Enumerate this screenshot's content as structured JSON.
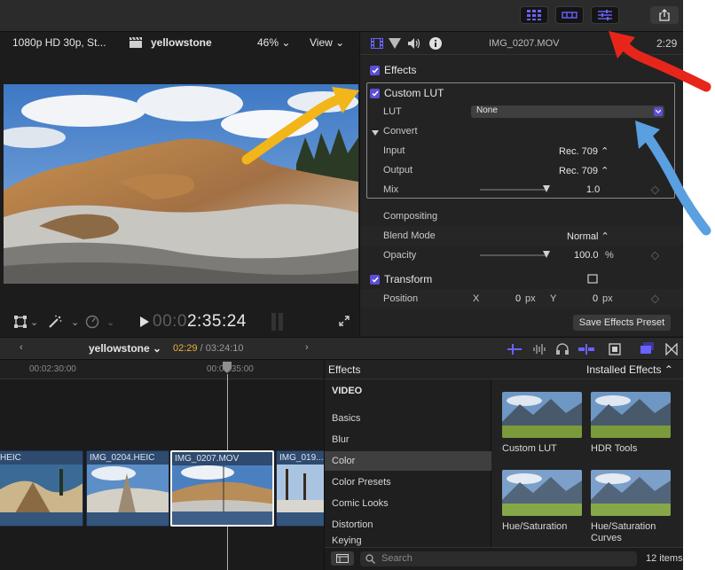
{
  "toolbar": {
    "icons": [
      "library-grid-icon",
      "timeline-icon",
      "inspector-sliders-icon",
      "share-icon"
    ]
  },
  "viewer": {
    "format": "1080p HD 30p, St...",
    "project": "yellowstone",
    "zoom": "46%",
    "view_menu": "View",
    "timecode_dim": "00:0",
    "timecode": "2:35:24"
  },
  "inspector": {
    "filename": "IMG_0207.MOV",
    "duration": "2:29",
    "effects_label": "Effects",
    "custom_lut_label": "Custom LUT",
    "lut_label": "LUT",
    "lut_value": "None",
    "convert_label": "Convert",
    "input_label": "Input",
    "input_value": "Rec. 709",
    "output_label": "Output",
    "output_value": "Rec. 709",
    "mix_label": "Mix",
    "mix_value": "1.0",
    "mix_level": 1.0,
    "compositing_label": "Compositing",
    "blend_label": "Blend Mode",
    "blend_value": "Normal",
    "opacity_label": "Opacity",
    "opacity_value": "100.0",
    "opacity_unit": "%",
    "opacity_level": 1.0,
    "transform_label": "Transform",
    "position_label": "Position",
    "pos_x_label": "X",
    "pos_x_value": "0",
    "pos_y_label": "Y",
    "pos_y_value": "0",
    "px_unit": "px",
    "save_preset": "Save Effects Preset"
  },
  "timeline": {
    "project": "yellowstone",
    "current": "02:29",
    "total": "03:24:10",
    "ruler_a": "00:02:30:00",
    "ruler_b": "00:02:35:00",
    "clips": [
      "HEIC",
      "IMG_0204.HEIC",
      "IMG_0207.MOV",
      "IMG_019..."
    ]
  },
  "effects": {
    "header": "Effects",
    "installed": "Installed Effects",
    "categories": [
      "VIDEO",
      "Basics",
      "Blur",
      "Color",
      "Color Presets",
      "Comic Looks",
      "Distortion",
      "Keying"
    ],
    "selected": "Color",
    "tiles": [
      "Custom LUT",
      "HDR Tools",
      "Hue/Saturation",
      "Hue/Saturation Curves"
    ],
    "search_placeholder": "Search",
    "count": "12 items"
  },
  "colors": {
    "accent": "#5b4fd6",
    "red_arrow": "#e8251b",
    "yellow_arrow": "#f2b51a",
    "blue_arrow": "#5a9fe0"
  }
}
